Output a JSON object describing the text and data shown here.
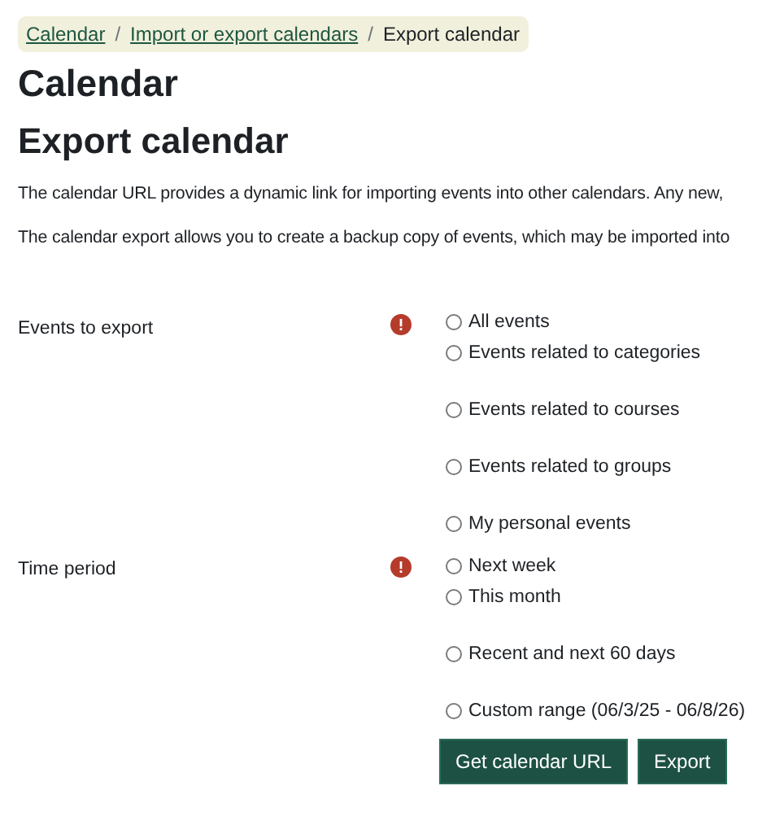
{
  "breadcrumb": [
    {
      "label": "Calendar",
      "link": true
    },
    {
      "label": "Import or export calendars",
      "link": true
    },
    {
      "label": "Export calendar",
      "link": false
    }
  ],
  "breadcrumb_separators": [
    "/",
    "/"
  ],
  "heading": "Calendar",
  "subheading": "Export calendar",
  "paragraphs": [
    "The calendar URL provides a dynamic link for importing events into other calendars. Any new,",
    "The calendar export allows you to create a backup copy of events, which may be imported into"
  ],
  "fields": [
    {
      "label": "Events to export",
      "required": true,
      "options": [
        {
          "label": "All events",
          "selected": false
        },
        {
          "label": "Events related to categories",
          "selected": false
        },
        {
          "label": "Events related to courses",
          "selected": false
        },
        {
          "label": "Events related to groups",
          "selected": false
        },
        {
          "label": "My personal events",
          "selected": false
        }
      ]
    },
    {
      "label": "Time period",
      "required": true,
      "options": [
        {
          "label": "Next week",
          "selected": false
        },
        {
          "label": "This month",
          "selected": false
        },
        {
          "label": "Recent and next 60 days",
          "selected": false
        },
        {
          "label": "Custom range (06/3/25 - 06/8/26)",
          "selected": false
        }
      ]
    }
  ],
  "buttons": [
    "Get calendar URL",
    "Export"
  ]
}
